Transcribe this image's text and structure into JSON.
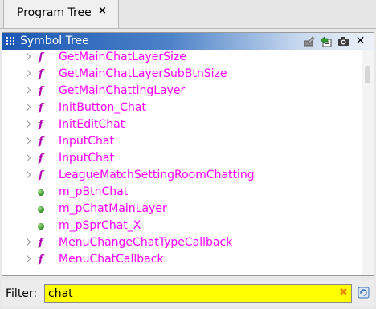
{
  "tab": {
    "label": "Program Tree",
    "close": "×"
  },
  "panel": {
    "title": "Symbol Tree",
    "toolbar_icons": [
      "edit-icon",
      "navigate-icon",
      "snapshot-icon",
      "close-icon"
    ],
    "close_glyph": "✕"
  },
  "tree": {
    "rows": [
      {
        "kind": "function",
        "label": "GetMainChatLayerSize",
        "icon": "function-icon",
        "glyph": "f"
      },
      {
        "kind": "function",
        "label": "GetMainChatLayerSubBtnSize",
        "icon": "function-icon",
        "glyph": "f"
      },
      {
        "kind": "function",
        "label": "GetMainChattingLayer",
        "icon": "function-icon",
        "glyph": "f"
      },
      {
        "kind": "function",
        "label": "InitButton_Chat",
        "icon": "function-icon",
        "glyph": "f"
      },
      {
        "kind": "function",
        "label": "InitEditChat",
        "icon": "function-icon",
        "glyph": "f"
      },
      {
        "kind": "function",
        "label": "InputChat",
        "icon": "function-icon",
        "glyph": "f"
      },
      {
        "kind": "function",
        "label": "InputChat",
        "icon": "function-icon",
        "glyph": "f"
      },
      {
        "kind": "function",
        "label": "LeagueMatchSettingRoomChatting",
        "icon": "function-icon",
        "glyph": "f"
      },
      {
        "kind": "field",
        "label": "m_pBtnChat",
        "icon": "field-dot-icon"
      },
      {
        "kind": "field",
        "label": "m_pChatMainLayer",
        "icon": "field-dot-icon"
      },
      {
        "kind": "field",
        "label": "m_pSprChat_X",
        "icon": "field-dot-icon"
      },
      {
        "kind": "function",
        "label": "MenuChangeChatTypeCallback",
        "icon": "function-icon",
        "glyph": "f"
      },
      {
        "kind": "function",
        "label": "MenuChatCallback",
        "icon": "function-icon",
        "glyph": "f"
      }
    ],
    "label_color": "#ff00ff",
    "icon_color": "#b000b0"
  },
  "filter": {
    "label": "Filter:",
    "value": "chat",
    "background": "#ffff00",
    "clear_glyph": "✖"
  },
  "colors": {
    "title_start": "#1c58b4",
    "title_end": "#eef2f8"
  }
}
